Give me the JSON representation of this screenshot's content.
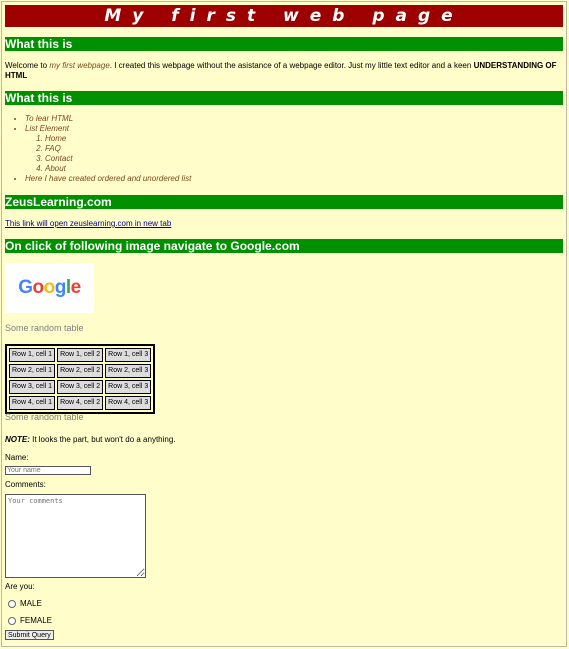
{
  "page": {
    "title": "My first web page"
  },
  "sections": {
    "s1_heading": "What this is",
    "intro": {
      "prefix": "Welcome to ",
      "emph": "my first webpage",
      "middle": ". I created this webpage without the asistance of a webpage editor. Just my little text editor and a keen ",
      "strong": "UNDERSTANDING OF HTML"
    },
    "s2_heading": "What this is",
    "list": {
      "items": [
        "To lear HTML",
        "List Element",
        "Here I have created ordered and unordered list"
      ],
      "sub_items": [
        "Home",
        "FAQ",
        "Contact",
        "About"
      ]
    },
    "s3_heading": "ZeusLearning.com",
    "link_text": "This link will open zeuslearning.com in new tab",
    "s4_heading": "On click of following image navigate to Google.com",
    "google_logo": {
      "text": "Google",
      "letters": [
        {
          "ch": "G",
          "color": "#4285f4"
        },
        {
          "ch": "o",
          "color": "#ea4335"
        },
        {
          "ch": "o",
          "color": "#fbbc05"
        },
        {
          "ch": "g",
          "color": "#4285f4"
        },
        {
          "ch": "l",
          "color": "#34a853"
        },
        {
          "ch": "e",
          "color": "#ea4335"
        }
      ]
    },
    "table_caption_top": "Some random table",
    "table_rows": [
      [
        "Row 1, cell 1",
        "Row 1, cell 2",
        "Row 1, cell 3"
      ],
      [
        "Row 2, cell 1",
        "Row 2, cell 2",
        "Row 2, cell 3"
      ],
      [
        "Row 3, cell 1",
        "Row 3, cell 2",
        "Row 3, cell 3"
      ],
      [
        "Row 4, cell 1",
        "Row 4, cell 2",
        "Row 4, cell 3"
      ]
    ],
    "table_caption_bottom": "Some random table"
  },
  "form": {
    "note_label": "NOTE:",
    "note_text": " It looks the part, but won't do a anything.",
    "name_label": "Name:",
    "name_placeholder": "Your name",
    "comments_label": "Comments:",
    "comments_placeholder": "Your comments",
    "are_you_label": "Are you:",
    "radio_male": "MALE",
    "radio_female": "FEMALE",
    "submit_label": "Submit Query"
  },
  "colors": {
    "title_bg": "#9c0000",
    "section_bg": "#009000",
    "page_bg": "#fffecb",
    "list_text": "#7a4a1a"
  }
}
